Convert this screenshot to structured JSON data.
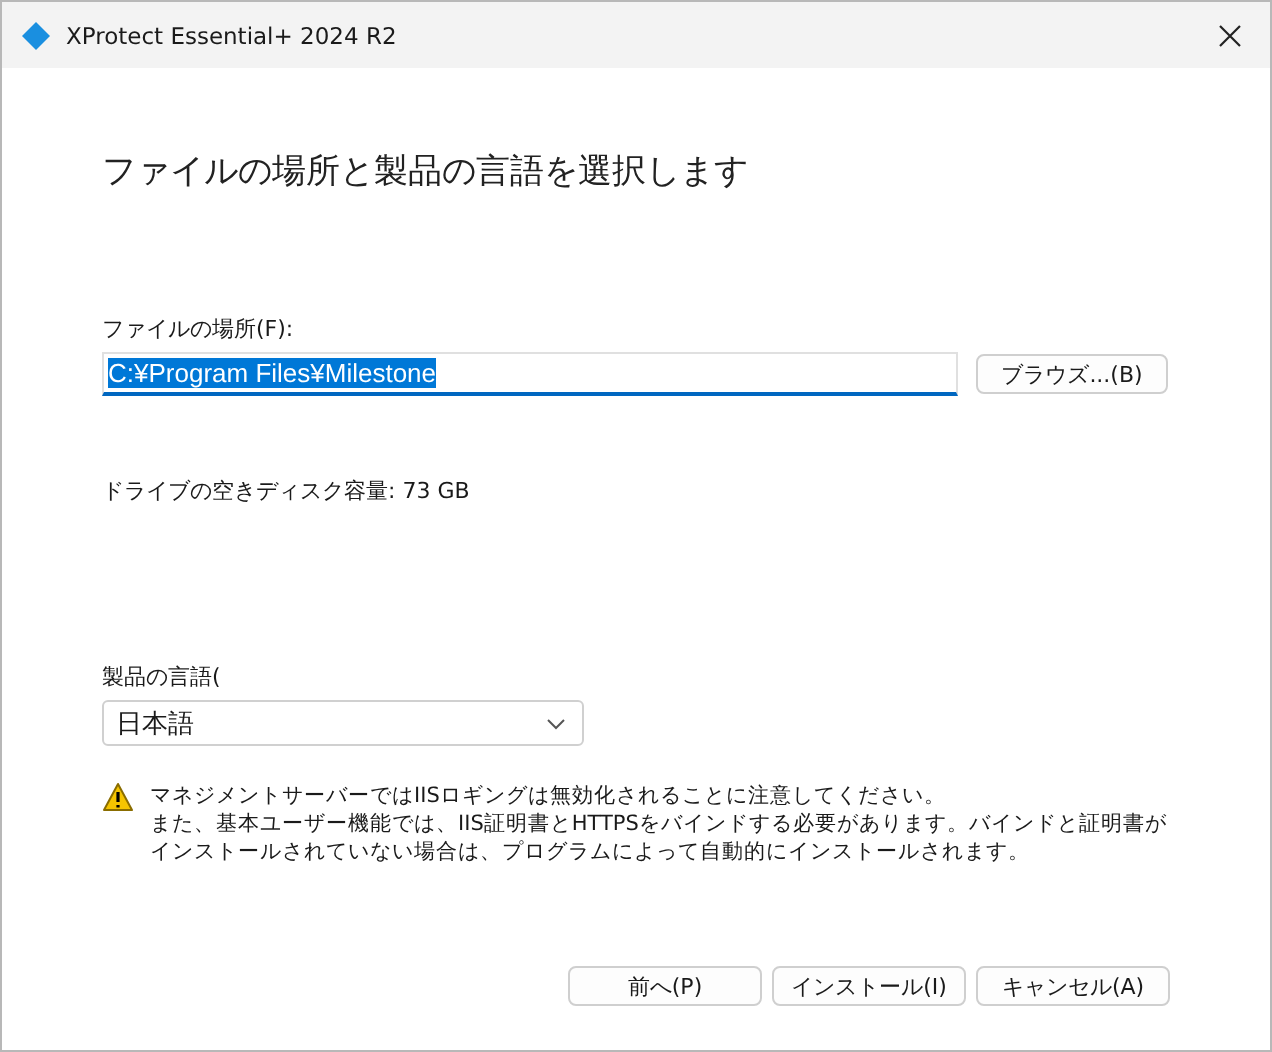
{
  "window": {
    "title": "XProtect Essential+ 2024 R2"
  },
  "heading": "ファイルの場所と製品の言語を選択します",
  "location": {
    "label": "ファイルの場所(F):",
    "value": "C:¥Program Files¥Milestone",
    "text_selected": true,
    "browse_button": "ブラウズ...(B)"
  },
  "disk_space": "ドライブの空きディスク容量: 73 GB",
  "language": {
    "label": "製品の言語(",
    "value": "日本語"
  },
  "warning": {
    "paragraphs": [
      "マネジメントサーバーではIISロギングは無効化されることに注意してください。",
      "また、基本ユーザー機能では、IIS証明書とHTTPSをバインドする必要があります。バインドと証明書がインストールされていない場合は、プログラムによって自動的にインストールされます。"
    ]
  },
  "buttons": [
    "前へ(P)",
    "インストール(I)",
    "キャンセル(A)"
  ]
}
